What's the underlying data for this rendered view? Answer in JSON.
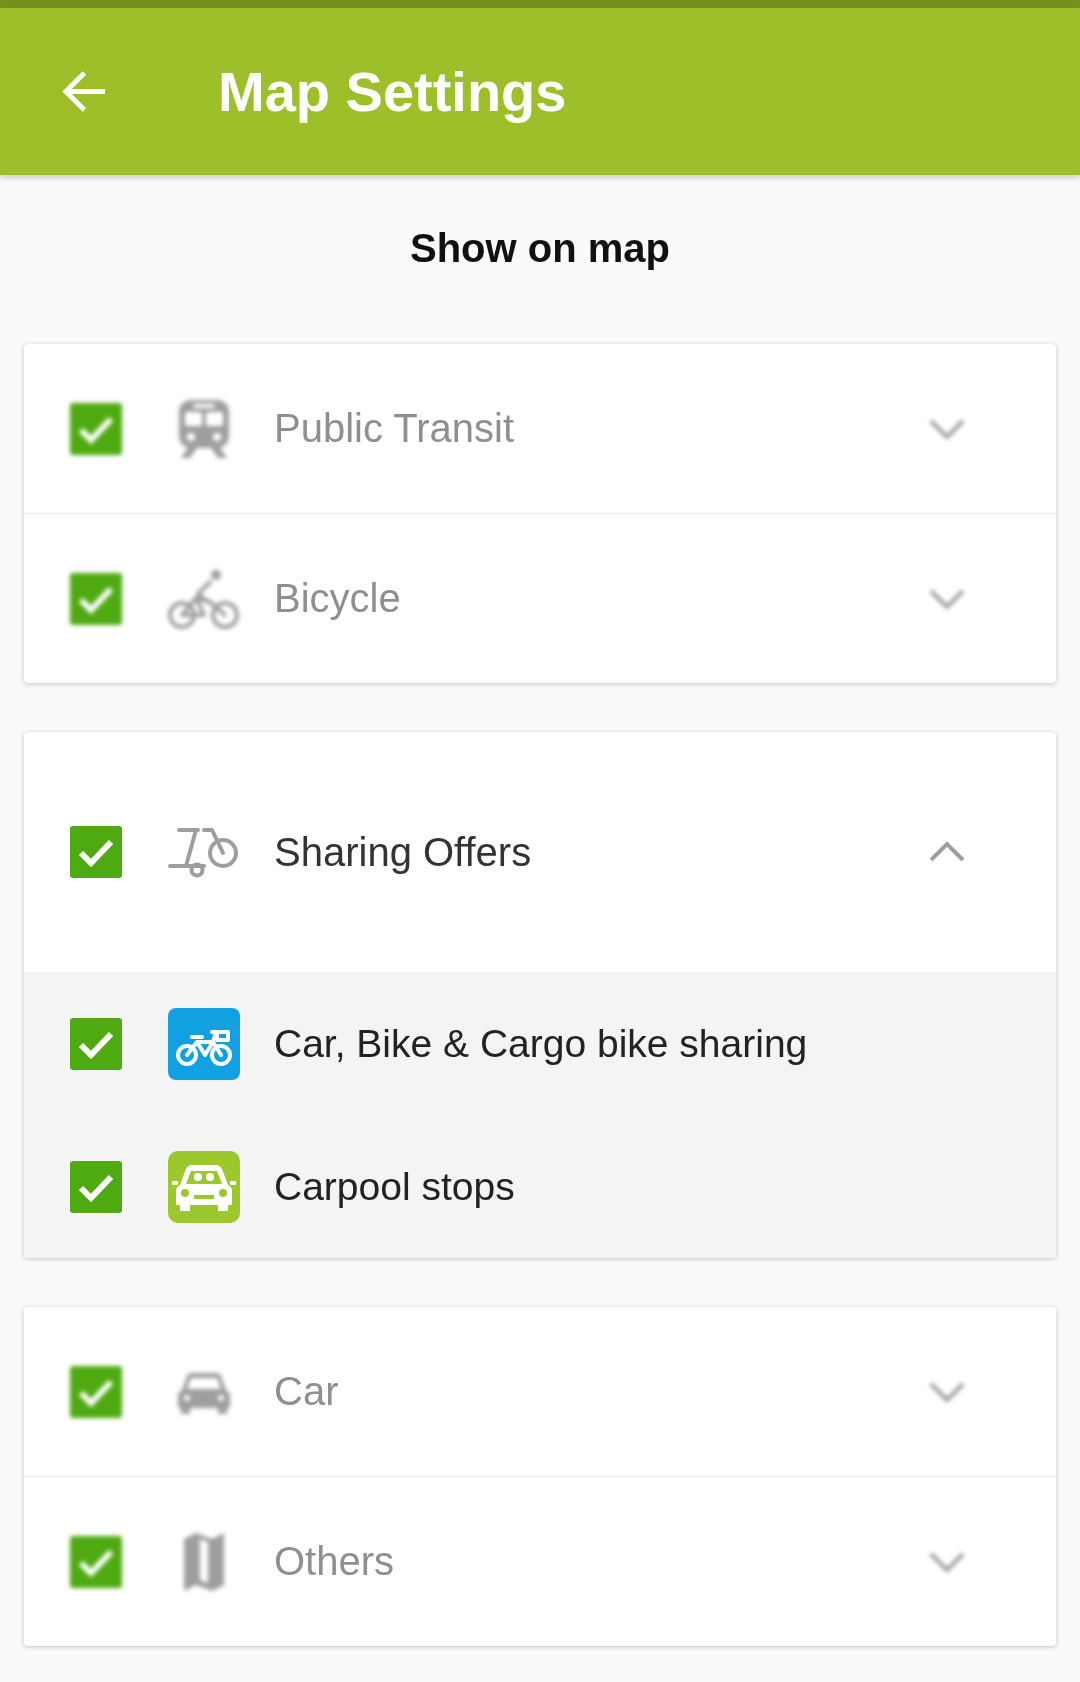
{
  "app_bar": {
    "title": "Map Settings"
  },
  "section_title": "Show on map",
  "groups": [
    {
      "blurred": true,
      "categories": [
        {
          "label": "Public Transit",
          "checked": true,
          "expanded": false
        },
        {
          "label": "Bicycle",
          "checked": true,
          "expanded": false
        }
      ]
    },
    {
      "blurred": false,
      "categories": [
        {
          "label": "Sharing Offers",
          "checked": true,
          "expanded": true,
          "children": [
            {
              "label": "Car, Bike & Cargo bike sharing",
              "checked": true
            },
            {
              "label": "Carpool stops",
              "checked": true
            }
          ]
        }
      ]
    },
    {
      "blurred": true,
      "categories": [
        {
          "label": "Car",
          "checked": true,
          "expanded": false
        },
        {
          "label": "Others",
          "checked": true,
          "expanded": false
        }
      ]
    }
  ]
}
